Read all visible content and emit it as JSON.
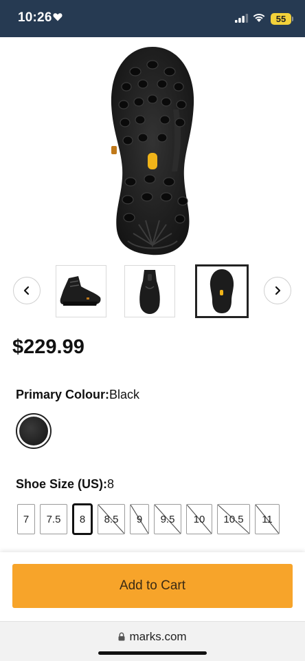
{
  "status_bar": {
    "time": "10:26",
    "battery": "55",
    "icons": [
      "heart-icon",
      "signal-icon",
      "wifi-icon",
      "battery-icon"
    ]
  },
  "product": {
    "price": "$229.99",
    "main_image": "boot-sole",
    "thumbnails": [
      "boot-side",
      "boot-back",
      "boot-sole"
    ],
    "selected_thumbnail": 2
  },
  "colour": {
    "label": "Primary Colour:",
    "value": "Black",
    "swatch_color": "#1e1e1e"
  },
  "shoe_size": {
    "label": "Shoe Size (US):",
    "value": "8",
    "options": [
      {
        "label": "7",
        "available": true,
        "selected": false
      },
      {
        "label": "7.5",
        "available": true,
        "selected": false
      },
      {
        "label": "8",
        "available": true,
        "selected": true
      },
      {
        "label": "8.5",
        "available": false,
        "selected": false
      },
      {
        "label": "9",
        "available": false,
        "selected": false
      },
      {
        "label": "9.5",
        "available": false,
        "selected": false
      },
      {
        "label": "10",
        "available": false,
        "selected": false
      },
      {
        "label": "10.5",
        "available": false,
        "selected": false
      },
      {
        "label": "11",
        "available": false,
        "selected": false
      }
    ]
  },
  "cart": {
    "button_label": "Add to Cart",
    "accent": "#f7a42a"
  },
  "browser": {
    "url": "marks.com"
  }
}
